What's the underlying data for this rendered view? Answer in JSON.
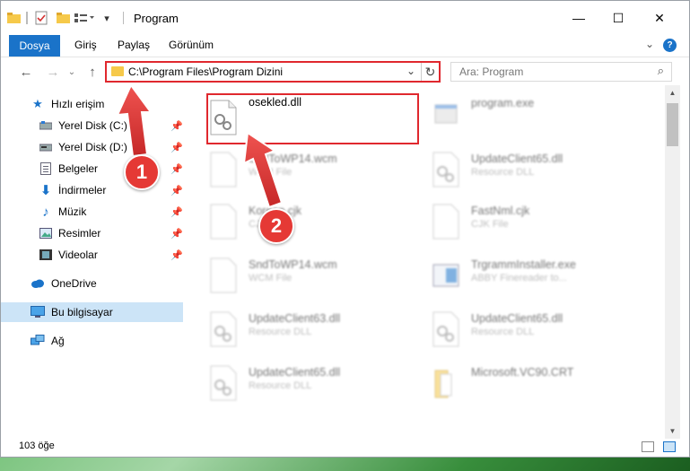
{
  "window": {
    "title": "Program",
    "controls": {
      "minimize": "—",
      "maximize": "☐",
      "close": "✕"
    }
  },
  "ribbon": {
    "file_tab": "Dosya",
    "tabs": [
      "Giriş",
      "Paylaş",
      "Görünüm"
    ],
    "help": "?"
  },
  "navigation": {
    "address": "C:\\Program Files\\Program Dizini",
    "search_placeholder": "Ara: Program"
  },
  "sidebar": {
    "items": [
      {
        "label": "Hızlı erişim",
        "icon": "star-icon",
        "pinned": false
      },
      {
        "label": "Yerel Disk (C:)",
        "icon": "drive-icon",
        "pinned": true
      },
      {
        "label": "Yerel Disk (D:)",
        "icon": "drive-icon",
        "pinned": true
      },
      {
        "label": "Belgeler",
        "icon": "documents-icon",
        "pinned": true
      },
      {
        "label": "İndirmeler",
        "icon": "download-icon",
        "pinned": true
      },
      {
        "label": "Müzik",
        "icon": "music-icon",
        "pinned": true
      },
      {
        "label": "Resimler",
        "icon": "pictures-icon",
        "pinned": true
      },
      {
        "label": "Videolar",
        "icon": "video-icon",
        "pinned": true
      },
      {
        "label": "OneDrive",
        "icon": "cloud-icon",
        "pinned": false
      },
      {
        "label": "Bu bilgisayar",
        "icon": "computer-icon",
        "pinned": false,
        "selected": true
      },
      {
        "label": "Ağ",
        "icon": "network-icon",
        "pinned": false
      }
    ]
  },
  "files": [
    {
      "name": "osekled.dll",
      "sub": "",
      "type": "dll",
      "highlighted": true
    },
    {
      "name": "program.exe",
      "sub": "",
      "type": "exe"
    },
    {
      "name": "SndToWP14.wcm",
      "sub": "WCM File",
      "type": "blank"
    },
    {
      "name": "UpdateClient65.dll",
      "sub": "Resource DLL",
      "type": "dll"
    },
    {
      "name": "Korean.cjk",
      "sub": "CJK File",
      "type": "blank"
    },
    {
      "name": "FastNml.cjk",
      "sub": "CJK File",
      "type": "blank"
    },
    {
      "name": "SndToWP14.wcm",
      "sub": "WCM File",
      "type": "blank"
    },
    {
      "name": "TrgrammInstaller.exe",
      "sub": "ABBY Finereader to...",
      "type": "app"
    },
    {
      "name": "UpdateClient63.dll",
      "sub": "Resource DLL",
      "type": "dll"
    },
    {
      "name": "UpdateClient65.dll",
      "sub": "Resource DLL",
      "type": "dll"
    },
    {
      "name": "UpdateClient65.dll",
      "sub": "Resource DLL",
      "type": "dll"
    },
    {
      "name": "Microsoft.VC90.CRT",
      "sub": "",
      "type": "folder"
    }
  ],
  "status": {
    "item_count": "103 öğe"
  },
  "callouts": [
    "1",
    "2"
  ],
  "colors": {
    "accent": "#1a73c9",
    "highlight": "#e0282e",
    "selected": "#cce4f7",
    "badge": "#e53935"
  }
}
